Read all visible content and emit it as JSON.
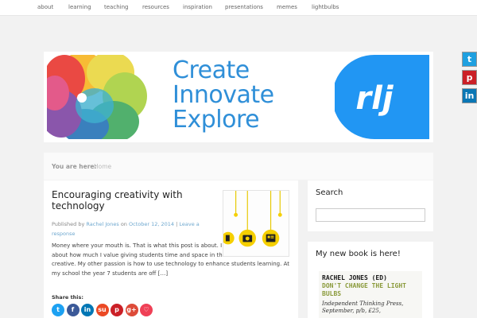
{
  "nav": {
    "items": [
      "about",
      "learning",
      "teaching",
      "resources",
      "inspiration",
      "presentations",
      "memes",
      "lightbulbs"
    ]
  },
  "banner": {
    "tagline": [
      "Create",
      "Innovate",
      "Explore"
    ],
    "badge_text": "rlj",
    "badge_color": "#2196f3"
  },
  "social": {
    "icons": [
      "twitter-icon",
      "pinterest-icon",
      "linkedin-icon"
    ],
    "twitter_glyph": "t",
    "pinterest_glyph": "p",
    "linkedin_glyph": "in"
  },
  "breadcrumb": {
    "label": "You are here:",
    "home": "Home"
  },
  "post": {
    "title": "Encouraging creativity with technology",
    "meta_published": "Published by",
    "author": "Rachel Jones",
    "meta_on": "on",
    "date": "October 12, 2014",
    "separator": "|",
    "leave_response": "Leave a response",
    "excerpt": "Money where your mouth is. That is what this post is about. I have written a fair bit about how much I value giving students time and space in the curriculum to be creative. My other passion is how to use technology to enhance students learning. At my school the year 7 students are off […]",
    "share_label": "Share this:",
    "share_buttons": [
      {
        "glyph": "t",
        "color": "#1da1f2",
        "icon": "twitter-icon"
      },
      {
        "glyph": "f",
        "color": "#3b5998",
        "icon": "facebook-icon"
      },
      {
        "glyph": "in",
        "color": "#0077b5",
        "icon": "linkedin-icon"
      },
      {
        "glyph": "su",
        "color": "#eb4924",
        "icon": "stumbleupon-icon"
      },
      {
        "glyph": "p",
        "color": "#cb2027",
        "icon": "pinterest-icon"
      },
      {
        "glyph": "g+",
        "color": "#dd4b39",
        "icon": "google-plus-icon"
      },
      {
        "glyph": "♡",
        "color": "#ef4056",
        "icon": "pocket-icon"
      }
    ]
  },
  "sidebar": {
    "search_title": "Search",
    "search_placeholder": "",
    "book_title": "My new book is here!",
    "book_author": "RACHEL JONES (ED)",
    "book_name": "DON'T CHANGE THE LIGHT BULBS",
    "book_publisher": "Independent Thinking Press, September, p/b, £25,"
  }
}
